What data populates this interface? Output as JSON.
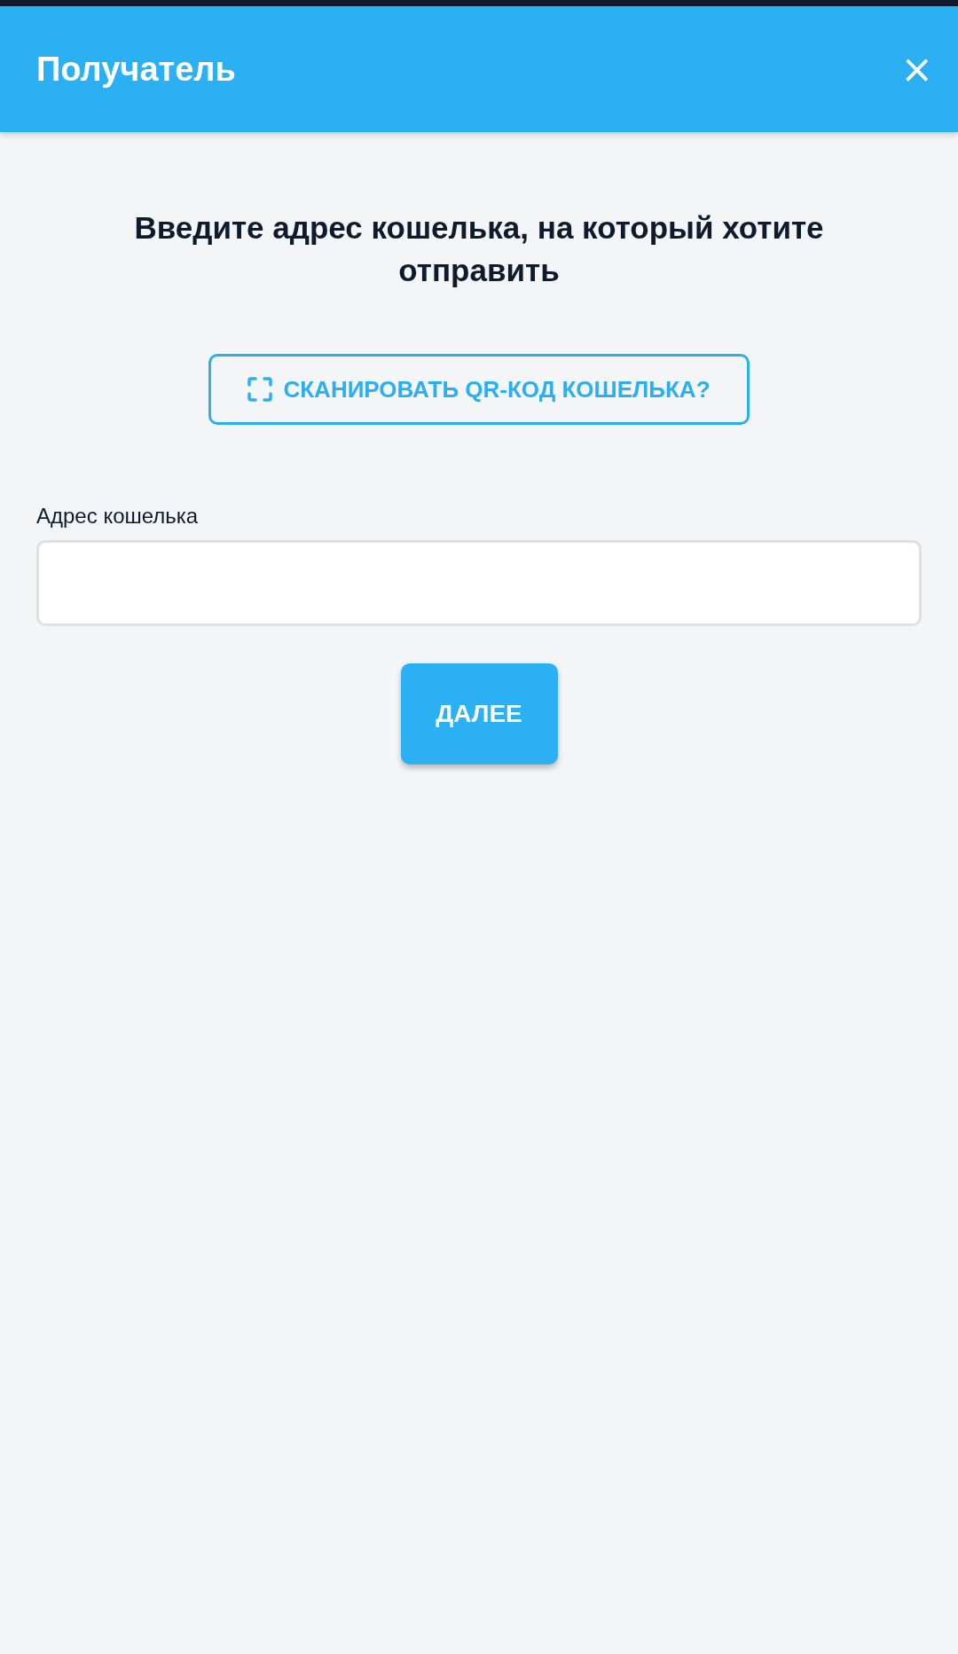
{
  "header": {
    "title": "Получатель",
    "close_symbol": "×"
  },
  "heading": "Введите адрес кошелька, на который хотите отправить",
  "scan_button": {
    "label": "СКАНИРОВАТЬ QR-КОД КОШЕЛЬКА?"
  },
  "address_field": {
    "label": "Адрес кошелька"
  },
  "next_button": {
    "label": "ДАЛЕЕ"
  }
}
